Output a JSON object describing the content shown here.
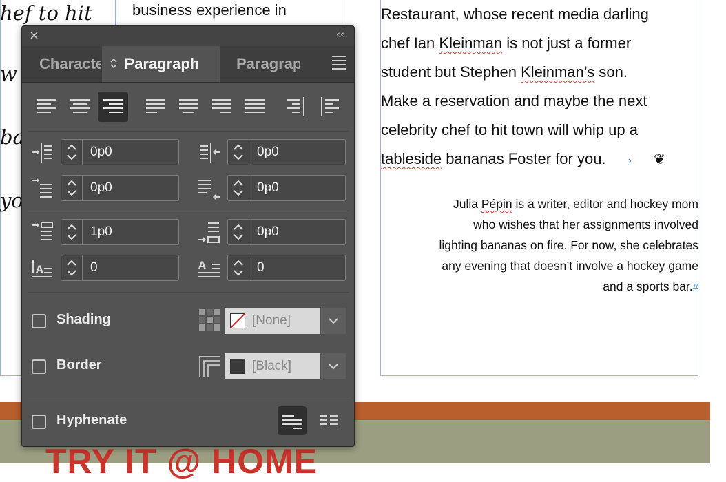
{
  "document": {
    "col1_lines": [
      "hef to hit",
      "w",
      "ba",
      "yo"
    ],
    "col2_line": "business experience in",
    "col3_lines": [
      "Restaurant, whose recent media darling",
      "chef Ian Kleinman is not just a former",
      "student but Stephen Kleinman’s son.",
      "Make a reservation and maybe the next",
      "celebrity chef to hit town will whip up a",
      "tableside bananas Foster for you."
    ],
    "col3_squiggle_words": [
      "Kleinman",
      "Kleinman’s",
      "tableside"
    ],
    "bio_lines": [
      "Julia Pépin is a writer, editor and hockey mom",
      "who wishes that her assignments involved",
      "lighting bananas on fire. For now, she celebrates",
      "any evening that doesn’t involve a hockey game",
      "and a sports bar."
    ],
    "bio_end_mark": "#",
    "headline": "TRY IT @ HOME"
  },
  "panel": {
    "close_glyph": "×",
    "collapse_glyph": "‹‹",
    "tabs": [
      {
        "label": "Character",
        "active": false
      },
      {
        "label": "Paragraph",
        "active": true
      },
      {
        "label": "Paragraph Styles",
        "active": false
      }
    ],
    "tab_active_glyph": "⌃⌄",
    "alignment_buttons": [
      {
        "name": "align-left",
        "selected": false
      },
      {
        "name": "align-center",
        "selected": false
      },
      {
        "name": "align-right",
        "selected": true
      },
      {
        "name": "justify-left",
        "selected": false
      },
      {
        "name": "justify-center",
        "selected": false
      },
      {
        "name": "justify-right",
        "selected": false
      },
      {
        "name": "justify-all",
        "selected": false
      },
      {
        "name": "align-towards-spine",
        "selected": false
      },
      {
        "name": "align-away-from-spine",
        "selected": false
      }
    ],
    "fields": {
      "left_indent": "0p0",
      "right_indent": "0p0",
      "first_line_indent": "0p0",
      "last_line_indent": "0p0",
      "space_before": "1p0",
      "space_after": "0p0",
      "drop_cap_lines": "0",
      "drop_cap_chars": "0"
    },
    "shading": {
      "label": "Shading",
      "checked": false,
      "swatch": "[None]"
    },
    "border": {
      "label": "Border",
      "checked": false,
      "swatch": "[Black]"
    },
    "hyphenate": {
      "label": "Hyphenate",
      "checked": false
    }
  },
  "colors": {
    "panel_bg": "#535353",
    "accent_orange": "#b95f2d",
    "headline_red": "#c9342c",
    "olive": "#9c9e82"
  }
}
